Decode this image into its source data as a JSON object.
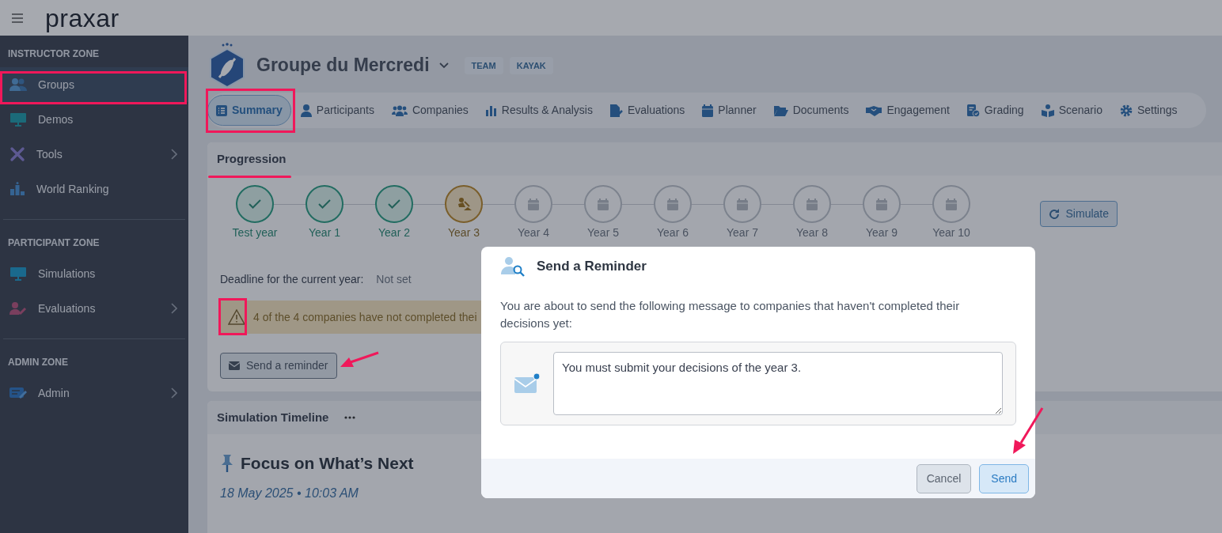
{
  "header": {
    "logo": "praxar"
  },
  "sidebar": {
    "sections": [
      {
        "title": "INSTRUCTOR ZONE",
        "items": [
          {
            "label": "Groups",
            "selected": true,
            "submenu": false
          },
          {
            "label": "Demos",
            "selected": false,
            "submenu": false
          },
          {
            "label": "Tools",
            "selected": false,
            "submenu": true
          },
          {
            "label": "World Ranking",
            "selected": false,
            "submenu": false
          }
        ]
      },
      {
        "title": "PARTICIPANT ZONE",
        "items": [
          {
            "label": "Simulations",
            "selected": false,
            "submenu": false
          },
          {
            "label": "Evaluations",
            "selected": false,
            "submenu": true
          }
        ]
      },
      {
        "title": "ADMIN ZONE",
        "items": [
          {
            "label": "Admin",
            "selected": false,
            "submenu": true
          }
        ]
      }
    ]
  },
  "group": {
    "title": "Groupe du Mercredi",
    "tags": [
      "TEAM",
      "KAYAK"
    ]
  },
  "tabs": [
    {
      "label": "Summary",
      "selected": true
    },
    {
      "label": "Participants",
      "selected": false
    },
    {
      "label": "Companies",
      "selected": false
    },
    {
      "label": "Results & Analysis",
      "selected": false
    },
    {
      "label": "Evaluations",
      "selected": false
    },
    {
      "label": "Planner",
      "selected": false
    },
    {
      "label": "Documents",
      "selected": false
    },
    {
      "label": "Engagement",
      "selected": false
    },
    {
      "label": "Grading",
      "selected": false
    },
    {
      "label": "Scenario",
      "selected": false
    },
    {
      "label": "Settings",
      "selected": false
    }
  ],
  "progression": {
    "title": "Progression",
    "steps": [
      {
        "label": "Test year",
        "kind": "done"
      },
      {
        "label": "Year 1",
        "kind": "done"
      },
      {
        "label": "Year 2",
        "kind": "done"
      },
      {
        "label": "Year 3",
        "kind": "current"
      },
      {
        "label": "Year 4",
        "kind": "pending"
      },
      {
        "label": "Year 5",
        "kind": "pending"
      },
      {
        "label": "Year 6",
        "kind": "pending"
      },
      {
        "label": "Year 7",
        "kind": "pending"
      },
      {
        "label": "Year 8",
        "kind": "pending"
      },
      {
        "label": "Year 9",
        "kind": "pending"
      },
      {
        "label": "Year 10",
        "kind": "pending"
      }
    ],
    "simulate_button": "Simulate",
    "deadline_label": "Deadline for the current year:",
    "deadline_value": "Not set",
    "alert": "4 of the 4 companies have not completed thei",
    "reminder_button": "Send a reminder"
  },
  "timeline": {
    "title": "Simulation Timeline",
    "heading": "Focus on What’s Next",
    "date": "18 May 2025 • 10:03 AM"
  },
  "modal": {
    "title": "Send a Reminder",
    "text": "You are about to send the following message to companies that haven't completed their decisions yet:",
    "message": "You must submit your decisions of the year 3.",
    "buttons": [
      {
        "label": "Cancel",
        "kind": "secondary"
      },
      {
        "label": "Send",
        "kind": "primary"
      }
    ]
  }
}
